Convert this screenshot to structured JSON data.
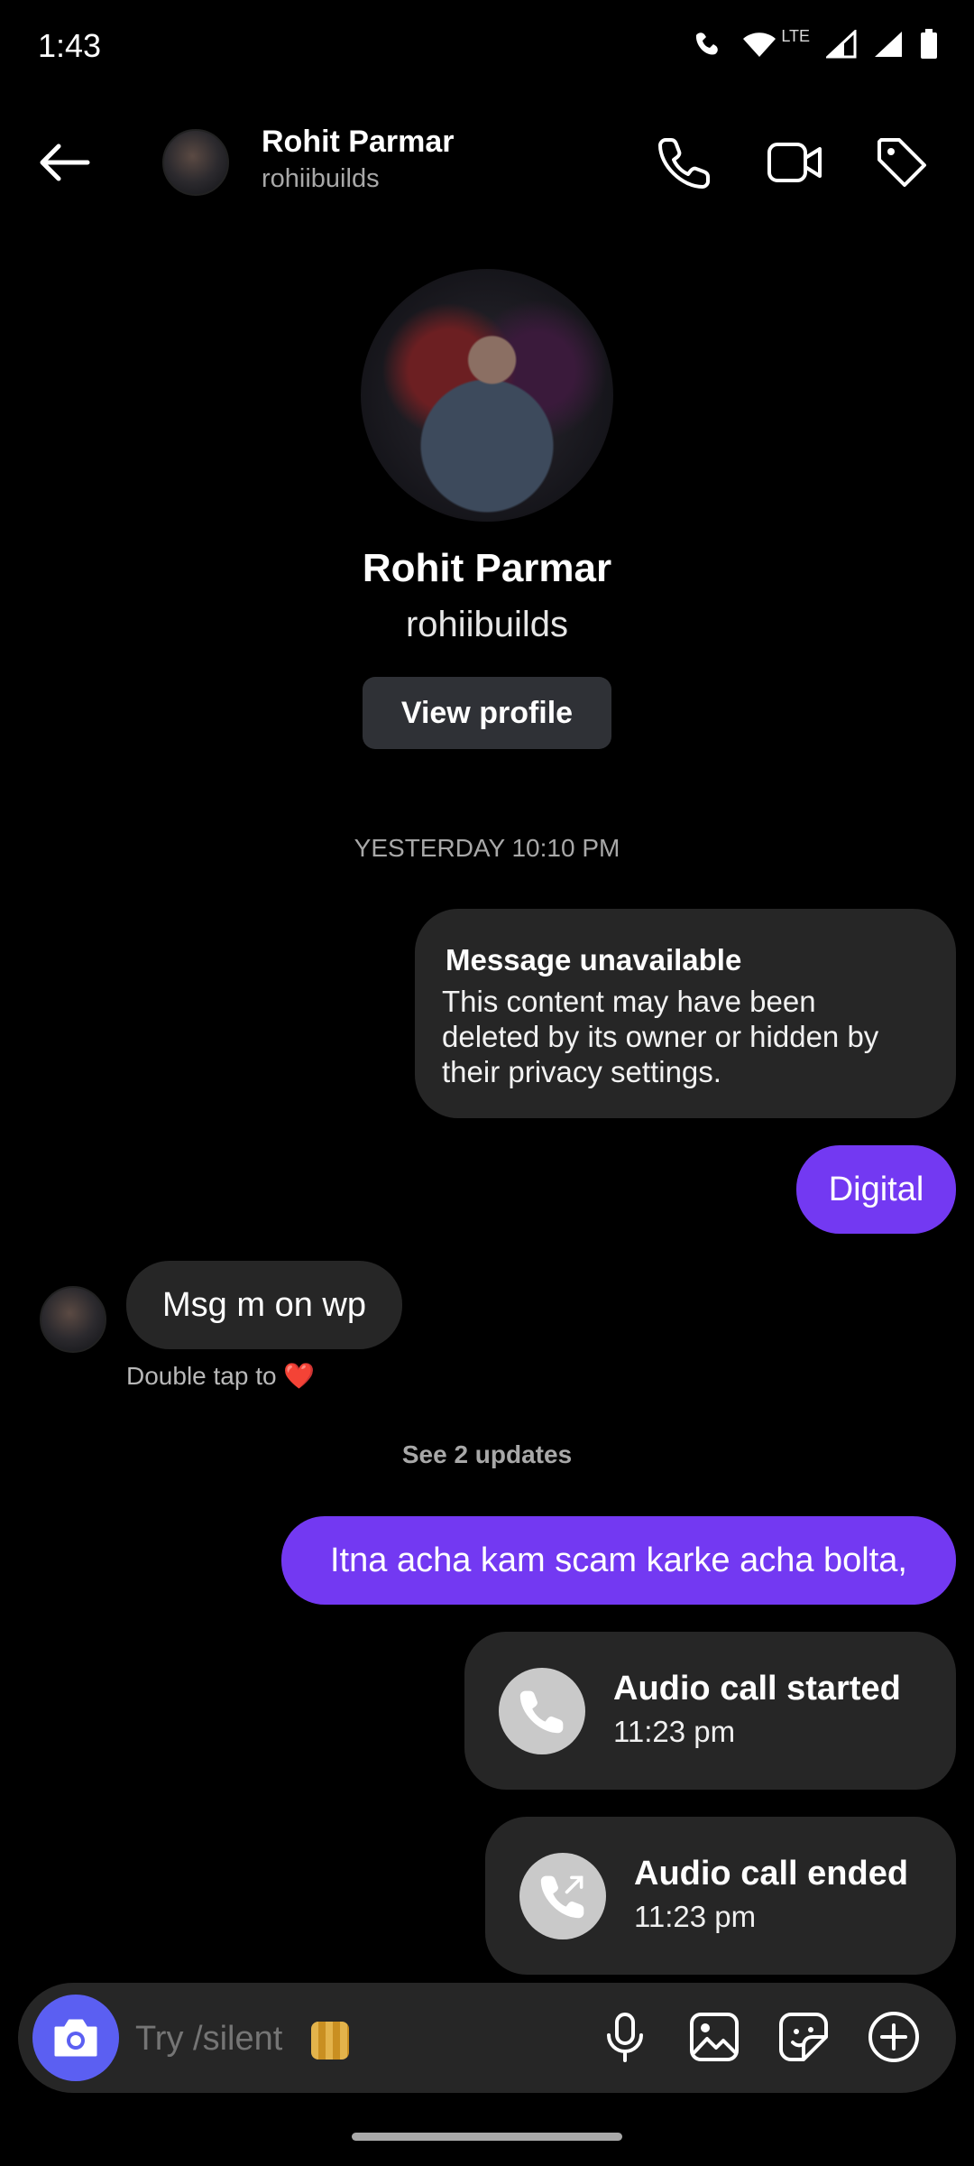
{
  "status_bar": {
    "time": "1:43",
    "network": "LTE"
  },
  "header": {
    "name": "Rohit Parmar",
    "username": "rohiibuilds",
    "icons": [
      "back-arrow-icon",
      "phone-icon",
      "video-camera-icon",
      "tag-icon"
    ]
  },
  "profile": {
    "name": "Rohit Parmar",
    "username": "rohiibuilds",
    "view_profile_label": "View profile"
  },
  "chat": {
    "timestamp": "YESTERDAY 10:10 PM",
    "unavailable_title": "Message unavailable",
    "unavailable_text": "This content may have been deleted by its owner or hidden by their privacy settings.",
    "msg_digital": "Digital",
    "msg_received": "Msg m on wp",
    "double_tap_hint": "Double tap to ❤️",
    "see_updates": "See 2 updates",
    "msg_long": "Itna acha kam scam karke acha bolta,",
    "call_started_title": "Audio call started",
    "call_started_time": "11:23 pm",
    "call_ended_title": "Audio call ended",
    "call_ended_time": "11:23 pm"
  },
  "composer": {
    "placeholder": "Try /silent",
    "icons": [
      "camera-icon",
      "microphone-icon",
      "gallery-icon",
      "sticker-icon",
      "add-icon"
    ]
  },
  "colors": {
    "accent_purple": "#7339f2",
    "camera_button": "#5b5ff2",
    "bubble_gray": "#262626"
  }
}
